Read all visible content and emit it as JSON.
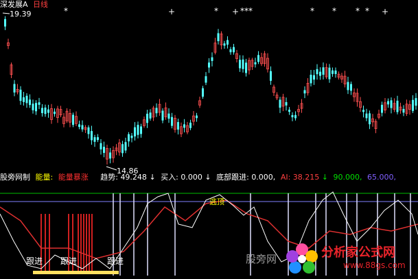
{
  "price_panel": {
    "stock_name": "深发展A",
    "period": "日线",
    "high_label": "19.39",
    "low_label": "14.86",
    "marker_star": "*",
    "marker_cross": "+"
  },
  "indicator_panel": {
    "name": "股旁网制",
    "energy_label": "能量:",
    "energy_value": "能量暴涨",
    "trend_label": "趋势:",
    "trend_value": "49.248",
    "trend_arrow": "↓",
    "buy_label": "买入:",
    "buy_value": "0.000",
    "buy_arrow": "↓",
    "bottom_label": "底部跟进:",
    "bottom_value": "0.000,",
    "ai_label": "AI:",
    "ai_value": "38.215",
    "ai_arrow": "↓",
    "v90_value": "90.000,",
    "v65_value": "65.000,",
    "annotation_escape": "逃顶",
    "follow_labels": [
      "跟进",
      "跟进",
      "跟进"
    ]
  },
  "watermarks": {
    "left_text": "股旁网",
    "brand_title": "分析家公式网",
    "brand_url": "www.88gs.com"
  },
  "colors": {
    "up": "#ff5050",
    "down": "#54ffff",
    "white_line": "#ffffff",
    "red_line": "#e03030",
    "green_line": "#00c000",
    "purple_line": "#8080ff",
    "yellow": "#ffff00",
    "brand_red": "#e8232a"
  }
}
